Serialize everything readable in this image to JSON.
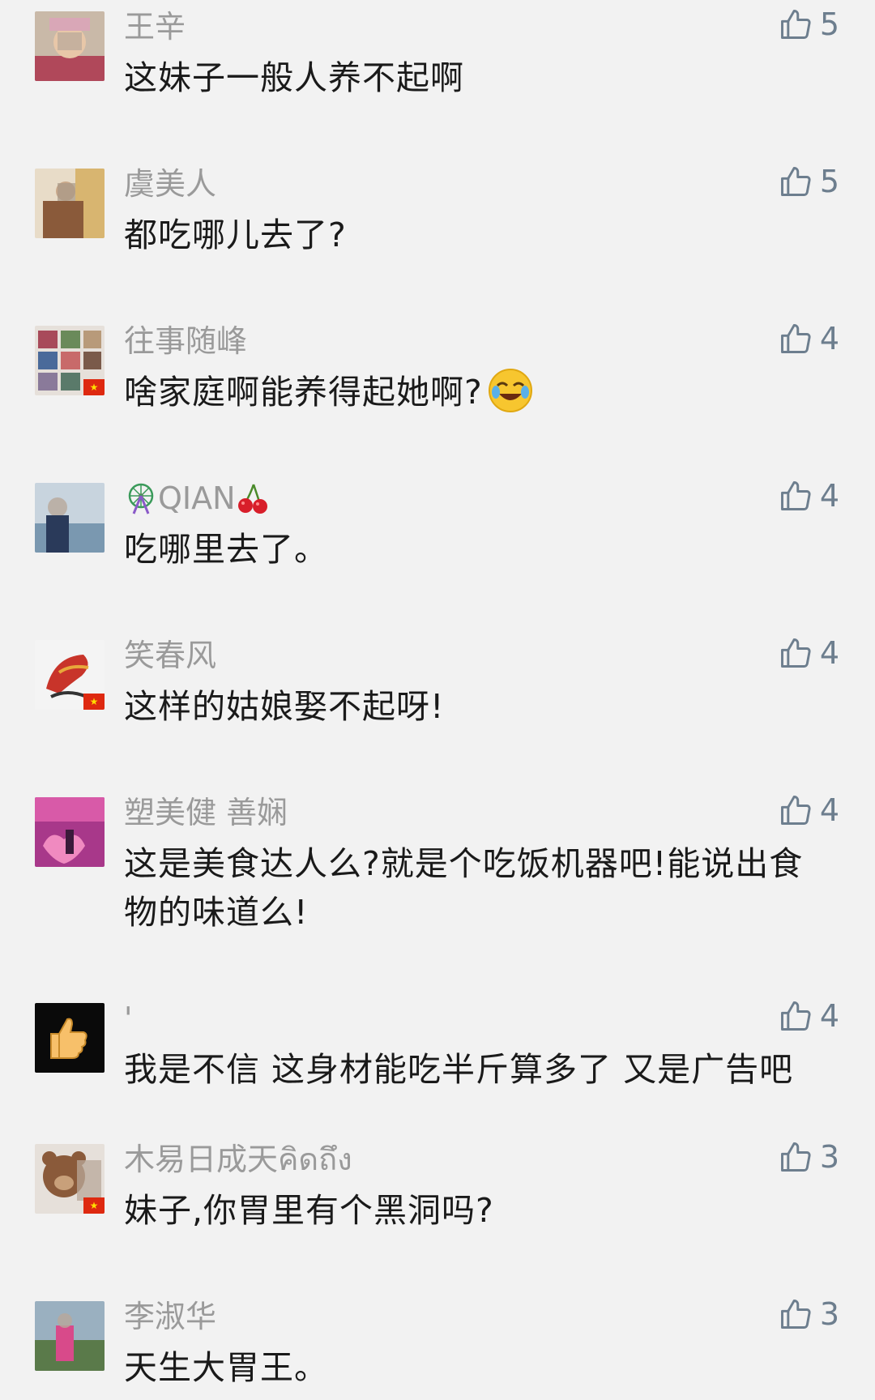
{
  "comments": [
    {
      "name": "王辛",
      "text": "这妹子一般人养不起啊",
      "likes": "5"
    },
    {
      "name": "虞美人",
      "text": "都吃哪儿去了?",
      "likes": "5"
    },
    {
      "name": "往事随峰",
      "text": "啥家庭啊能养得起她啊?",
      "likes": "4"
    },
    {
      "name": "QIAN",
      "text": "吃哪里去了。",
      "likes": "4"
    },
    {
      "name": "笑春风",
      "text": "这样的姑娘娶不起呀!",
      "likes": "4"
    },
    {
      "name": "塑美健 善娴",
      "text": "这是美食达人么?就是个吃饭机器吧!能说出食物的味道么!",
      "likes": "4"
    },
    {
      "name": "'",
      "text": "我是不信 这身材能吃半斤算多了 又是广告吧",
      "likes": "4"
    },
    {
      "name": "木易日成天คิดถึง",
      "text": "妹子,你胃里有个黑洞吗?",
      "likes": "3"
    },
    {
      "name": "李淑华",
      "text": "天生大胃王。",
      "likes": "3"
    }
  ],
  "icons": {
    "like": "thumbs-up-outline-icon",
    "laugh_cry": "rolling-laugh-emoji",
    "ferris_wheel": "ferris-wheel-emoji",
    "cherry": "cherries-emoji",
    "flag": "china-flag-badge"
  },
  "colors": {
    "background": "#f2f2f2",
    "name": "#9a9a9a",
    "text": "#1a1a1a",
    "like": "#6d7e8e"
  }
}
